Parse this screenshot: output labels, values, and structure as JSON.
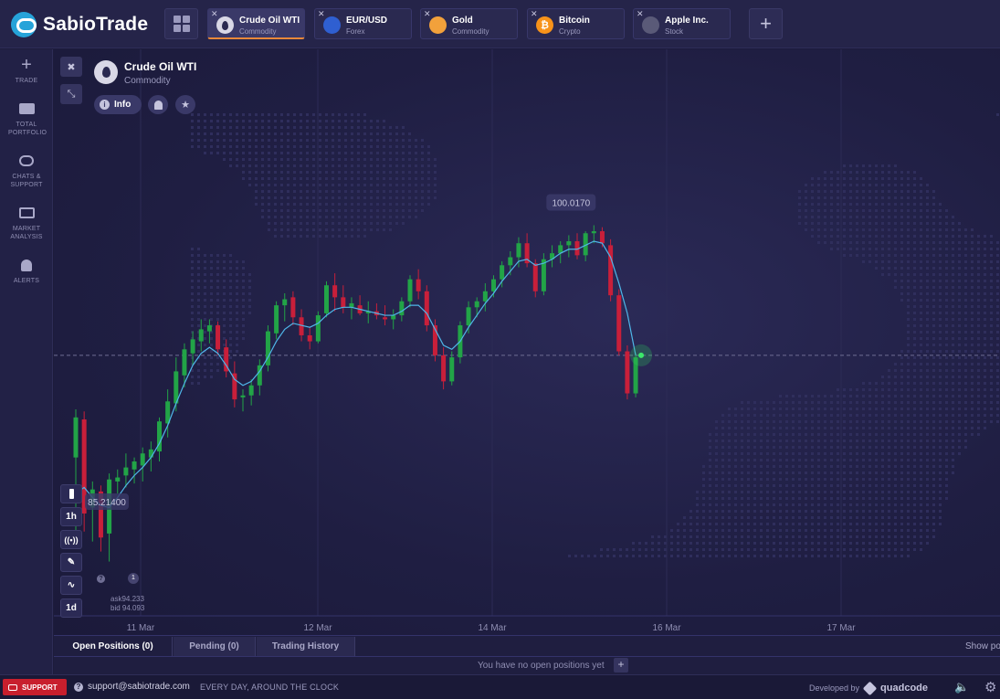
{
  "brand": {
    "name": "SabioTrade"
  },
  "tabs": [
    {
      "name": "Crude Oil WTI",
      "type": "Commodity",
      "icon": "oil-drop-icon",
      "color": "#d9d8e6",
      "active": true
    },
    {
      "name": "EUR/USD",
      "type": "Forex",
      "icon": "eur-usd-flag-icon",
      "color": "#2f5fd1",
      "active": false
    },
    {
      "name": "Gold",
      "type": "Commodity",
      "icon": "gold-bars-icon",
      "color": "#f2a13b",
      "active": false
    },
    {
      "name": "Bitcoin",
      "type": "Crypto",
      "icon": "bitcoin-icon",
      "color": "#f7931a",
      "active": false
    },
    {
      "name": "Apple Inc.",
      "type": "Stock",
      "icon": "apple-icon",
      "color": "#5a5a78",
      "active": false
    }
  ],
  "tab_glyphs": [
    "",
    "",
    "",
    "₿",
    ""
  ],
  "sidebar": {
    "items": [
      {
        "label": "TRADE",
        "icon": "plus-icon"
      },
      {
        "label": "TOTAL PORTFOLIO",
        "icon": "briefcase-icon"
      },
      {
        "label": "CHATS & SUPPORT",
        "icon": "chat-icon"
      },
      {
        "label": "MARKET ANALYSIS",
        "icon": "analysis-icon"
      },
      {
        "label": "ALERTS",
        "icon": "bell-icon"
      }
    ]
  },
  "asset": {
    "name": "Crude Oil WTI",
    "type": "Commodity",
    "info_label": "Info"
  },
  "tools": {
    "interval": "1h",
    "period": "1d",
    "indicator_count": "1"
  },
  "quotes": {
    "ask": "ask94.233",
    "bid": "bid 94.093"
  },
  "chart_data": {
    "type": "candlestick",
    "x_ticks": [
      "11 Mar",
      "12 Mar",
      "14 Mar",
      "16 Mar",
      "17 Mar"
    ],
    "high_label": "100.0170",
    "low_label": "85.21400",
    "current_price_line": 94.1,
    "ylim": [
      82,
      104
    ],
    "candles": [
      {
        "o": 89.0,
        "h": 91.4,
        "l": 84.6,
        "c": 91.0
      },
      {
        "o": 90.9,
        "h": 91.3,
        "l": 85.3,
        "c": 86.2
      },
      {
        "o": 86.5,
        "h": 87.8,
        "l": 84.8,
        "c": 87.4
      },
      {
        "o": 87.3,
        "h": 87.6,
        "l": 84.3,
        "c": 85.0
      },
      {
        "o": 85.2,
        "h": 88.2,
        "l": 83.8,
        "c": 87.9
      },
      {
        "o": 87.8,
        "h": 88.4,
        "l": 87.2,
        "c": 88.0
      },
      {
        "o": 88.1,
        "h": 89.2,
        "l": 87.5,
        "c": 88.5
      },
      {
        "o": 88.4,
        "h": 89.0,
        "l": 87.7,
        "c": 88.8
      },
      {
        "o": 88.6,
        "h": 89.5,
        "l": 87.8,
        "c": 89.2
      },
      {
        "o": 89.0,
        "h": 89.8,
        "l": 88.3,
        "c": 89.4
      },
      {
        "o": 89.3,
        "h": 91.0,
        "l": 88.8,
        "c": 90.8
      },
      {
        "o": 90.7,
        "h": 92.4,
        "l": 90.0,
        "c": 91.8
      },
      {
        "o": 91.7,
        "h": 94.0,
        "l": 91.3,
        "c": 93.3
      },
      {
        "o": 93.1,
        "h": 94.7,
        "l": 92.5,
        "c": 94.4
      },
      {
        "o": 94.2,
        "h": 95.3,
        "l": 93.6,
        "c": 94.9
      },
      {
        "o": 94.8,
        "h": 95.9,
        "l": 94.3,
        "c": 95.4
      },
      {
        "o": 95.3,
        "h": 95.9,
        "l": 94.7,
        "c": 95.6
      },
      {
        "o": 95.6,
        "h": 95.8,
        "l": 94.1,
        "c": 94.4
      },
      {
        "o": 94.5,
        "h": 94.9,
        "l": 93.0,
        "c": 93.3
      },
      {
        "o": 93.2,
        "h": 93.8,
        "l": 91.5,
        "c": 91.9
      },
      {
        "o": 92.0,
        "h": 92.4,
        "l": 91.3,
        "c": 92.1
      },
      {
        "o": 92.1,
        "h": 92.9,
        "l": 91.6,
        "c": 92.6
      },
      {
        "o": 92.6,
        "h": 93.9,
        "l": 92.1,
        "c": 93.6
      },
      {
        "o": 93.6,
        "h": 95.6,
        "l": 93.3,
        "c": 95.3
      },
      {
        "o": 95.2,
        "h": 96.8,
        "l": 94.9,
        "c": 96.6
      },
      {
        "o": 96.6,
        "h": 97.2,
        "l": 95.8,
        "c": 96.9
      },
      {
        "o": 97.0,
        "h": 97.3,
        "l": 95.6,
        "c": 96.0
      },
      {
        "o": 96.0,
        "h": 96.4,
        "l": 94.8,
        "c": 95.1
      },
      {
        "o": 95.1,
        "h": 95.5,
        "l": 94.4,
        "c": 94.8
      },
      {
        "o": 94.8,
        "h": 96.3,
        "l": 94.7,
        "c": 96.1
      },
      {
        "o": 96.2,
        "h": 97.8,
        "l": 96.0,
        "c": 97.6
      },
      {
        "o": 97.6,
        "h": 98.2,
        "l": 96.3,
        "c": 97.0
      },
      {
        "o": 97.0,
        "h": 97.6,
        "l": 96.2,
        "c": 96.5
      },
      {
        "o": 96.5,
        "h": 97.0,
        "l": 95.9,
        "c": 96.7
      },
      {
        "o": 96.6,
        "h": 97.1,
        "l": 96.1,
        "c": 96.2
      },
      {
        "o": 96.2,
        "h": 96.8,
        "l": 95.7,
        "c": 96.3
      },
      {
        "o": 96.3,
        "h": 96.7,
        "l": 95.9,
        "c": 96.1
      },
      {
        "o": 96.0,
        "h": 96.6,
        "l": 95.6,
        "c": 95.9
      },
      {
        "o": 95.9,
        "h": 96.4,
        "l": 95.4,
        "c": 96.1
      },
      {
        "o": 96.1,
        "h": 97.0,
        "l": 95.8,
        "c": 96.8
      },
      {
        "o": 96.8,
        "h": 98.1,
        "l": 96.5,
        "c": 97.9
      },
      {
        "o": 97.9,
        "h": 98.4,
        "l": 96.9,
        "c": 97.3
      },
      {
        "o": 97.3,
        "h": 97.6,
        "l": 95.3,
        "c": 95.6
      },
      {
        "o": 95.6,
        "h": 95.9,
        "l": 93.8,
        "c": 94.1
      },
      {
        "o": 94.1,
        "h": 94.5,
        "l": 92.4,
        "c": 92.8
      },
      {
        "o": 92.8,
        "h": 94.3,
        "l": 92.6,
        "c": 94.0
      },
      {
        "o": 94.0,
        "h": 95.8,
        "l": 93.7,
        "c": 95.6
      },
      {
        "o": 95.6,
        "h": 96.8,
        "l": 95.2,
        "c": 96.5
      },
      {
        "o": 96.5,
        "h": 97.0,
        "l": 96.0,
        "c": 96.8
      },
      {
        "o": 96.8,
        "h": 97.7,
        "l": 96.3,
        "c": 97.3
      },
      {
        "o": 97.3,
        "h": 98.1,
        "l": 97.0,
        "c": 97.9
      },
      {
        "o": 97.9,
        "h": 98.8,
        "l": 97.5,
        "c": 98.6
      },
      {
        "o": 98.6,
        "h": 99.3,
        "l": 98.1,
        "c": 99.0
      },
      {
        "o": 99.0,
        "h": 100.0,
        "l": 98.5,
        "c": 99.7
      },
      {
        "o": 99.7,
        "h": 100.2,
        "l": 98.5,
        "c": 98.7
      },
      {
        "o": 98.7,
        "h": 98.9,
        "l": 97.0,
        "c": 97.3
      },
      {
        "o": 97.3,
        "h": 99.2,
        "l": 97.1,
        "c": 98.9
      },
      {
        "o": 98.9,
        "h": 99.6,
        "l": 98.5,
        "c": 99.2
      },
      {
        "o": 99.2,
        "h": 99.8,
        "l": 98.7,
        "c": 99.6
      },
      {
        "o": 99.6,
        "h": 100.1,
        "l": 99.0,
        "c": 99.8
      },
      {
        "o": 99.8,
        "h": 100.2,
        "l": 98.9,
        "c": 99.1
      },
      {
        "o": 99.1,
        "h": 100.3,
        "l": 98.8,
        "c": 100.2
      },
      {
        "o": 100.2,
        "h": 100.6,
        "l": 99.7,
        "c": 100.3
      },
      {
        "o": 100.3,
        "h": 100.5,
        "l": 99.5,
        "c": 99.7
      },
      {
        "o": 99.6,
        "h": 99.9,
        "l": 96.8,
        "c": 97.1
      },
      {
        "o": 97.1,
        "h": 97.4,
        "l": 94.1,
        "c": 94.3
      },
      {
        "o": 94.3,
        "h": 94.6,
        "l": 91.9,
        "c": 92.2
      },
      {
        "o": 92.2,
        "h": 94.2,
        "l": 92.0,
        "c": 94.0
      }
    ],
    "ma": [
      87.2,
      87.5,
      87.0,
      86.6,
      86.5,
      87.0,
      87.6,
      88.1,
      88.5,
      89.0,
      89.7,
      90.6,
      91.7,
      92.7,
      93.6,
      94.2,
      94.5,
      94.2,
      93.6,
      92.9,
      92.6,
      92.8,
      93.3,
      94.0,
      94.8,
      95.4,
      95.7,
      95.6,
      95.5,
      95.7,
      96.1,
      96.4,
      96.5,
      96.5,
      96.4,
      96.3,
      96.2,
      96.1,
      96.1,
      96.3,
      96.6,
      96.6,
      96.2,
      95.4,
      94.6,
      94.4,
      94.8,
      95.5,
      96.1,
      96.7,
      97.2,
      97.8,
      98.3,
      98.8,
      98.9,
      98.6,
      98.7,
      98.9,
      99.2,
      99.4,
      99.4,
      99.6,
      99.8,
      99.7,
      99.0,
      97.7,
      96.2,
      94.1
    ]
  },
  "bottom": {
    "tabs": [
      "Open Positions (0)",
      "Pending (0)",
      "Trading History"
    ],
    "empty": "You have no open positions yet",
    "show_more": "Show po"
  },
  "footer": {
    "support": "SUPPORT",
    "email": "support@sabiotrade.com",
    "hours": "EVERY DAY, AROUND THE CLOCK",
    "developed_by": "Developed by",
    "developer": "quadcode"
  },
  "colors": {
    "up": "#22a447",
    "down": "#c81f3a",
    "ma": "#4fb6e8",
    "bg": "#1d1c3c"
  }
}
